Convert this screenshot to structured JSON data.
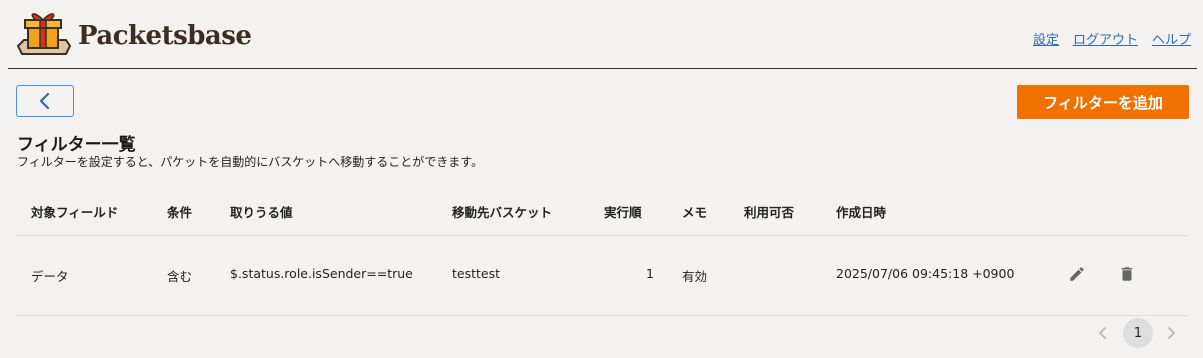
{
  "header": {
    "brand": "Packetsbase",
    "links": [
      "設定",
      "ログアウト",
      "ヘルプ"
    ]
  },
  "toolbar": {
    "add_filter_label": "フィルターを追加"
  },
  "page": {
    "title": "フィルター一覧",
    "description": "フィルターを設定すると、パケットを自動的にバスケットへ移動することができます。"
  },
  "table": {
    "headers": [
      "対象フィールド",
      "条件",
      "取りうる値",
      "移動先バスケット",
      "実行順",
      "メモ",
      "利用可否",
      "作成日時"
    ],
    "rows": [
      {
        "field": "データ",
        "condition": "含む",
        "value": "$.status.role.isSender==true",
        "basket": "testtest",
        "order": "1",
        "memo": "有効",
        "enabled": "",
        "created": "2025/07/06 09:45:18 +0900"
      }
    ]
  },
  "pagination": {
    "current_page": "1"
  },
  "colors": {
    "accent_orange": "#f07000",
    "link_blue": "#2b6cb0",
    "background": "#f3f2f0"
  },
  "icons": {
    "logo": "gift-box-icon",
    "back": "chevron-left-icon",
    "edit": "pencil-icon",
    "delete": "trash-icon",
    "prev": "chevron-left-icon",
    "next": "chevron-right-icon"
  }
}
